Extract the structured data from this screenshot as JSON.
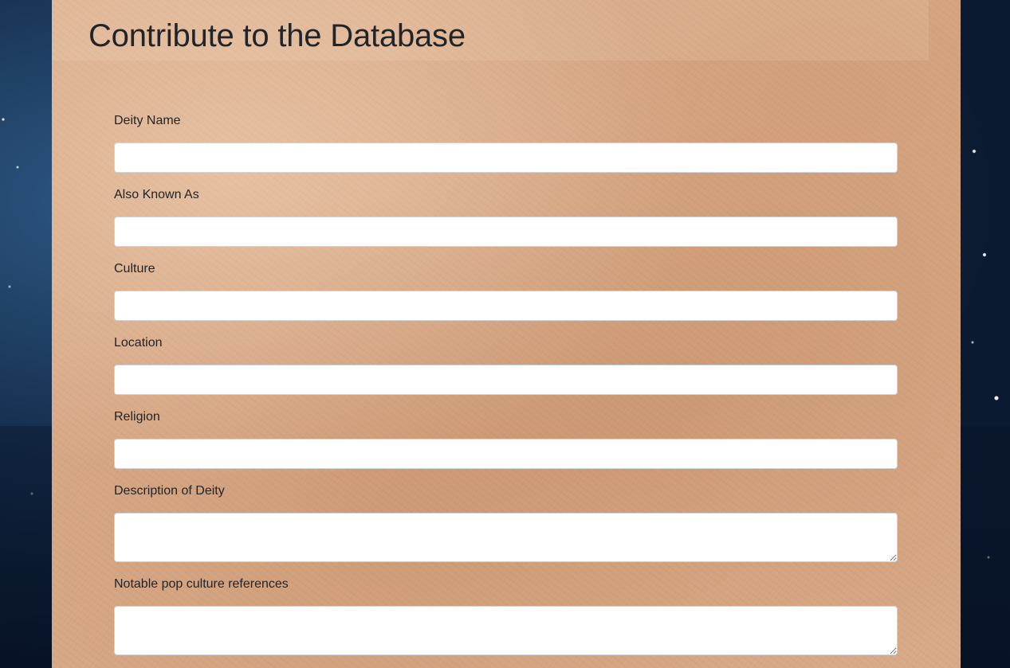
{
  "page": {
    "title": "Contribute to the Database"
  },
  "form": {
    "fields": [
      {
        "label": "Deity Name",
        "value": "",
        "type": "text"
      },
      {
        "label": "Also Known As",
        "value": "",
        "type": "text"
      },
      {
        "label": "Culture",
        "value": "",
        "type": "text"
      },
      {
        "label": "Location",
        "value": "",
        "type": "text"
      },
      {
        "label": "Religion",
        "value": "",
        "type": "text"
      },
      {
        "label": "Description of Deity",
        "value": "",
        "type": "textarea"
      },
      {
        "label": "Notable pop culture references",
        "value": "",
        "type": "textarea"
      }
    ]
  },
  "colors": {
    "panel": "#d8a987",
    "background": "#0b1a30",
    "text": "#212529",
    "input_border": "#ced4da"
  }
}
